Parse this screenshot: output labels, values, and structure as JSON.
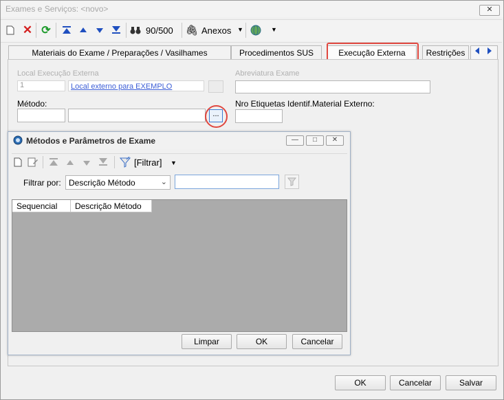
{
  "window": {
    "title": "Exames e Serviços: <novo>",
    "close_label": "✕"
  },
  "toolbar": {
    "counter": "90/500",
    "attachments_label": "Anexos",
    "icons": [
      "new-icon",
      "delete-icon",
      "refresh-icon",
      "first-icon",
      "prev-icon",
      "next-icon",
      "last-icon",
      "binoculars-icon",
      "paperclip-icon",
      "dropdown-arrow-icon",
      "globe-icon",
      "dropdown-arrow-icon"
    ]
  },
  "tabs": [
    {
      "label": "Materiais do Exame / Preparações / Vasilhames",
      "active": false
    },
    {
      "label": "Procedimentos SUS",
      "active": false
    },
    {
      "label": "Execução Externa",
      "active": true
    },
    {
      "label": "Restrições",
      "active": false
    }
  ],
  "form": {
    "local_label": "Local Execução Externa",
    "local_code": "1",
    "local_link": "Local externo para EXEMPLO",
    "abrev_label": "Abreviatura Exame",
    "metodo_label": "Método:",
    "metodo_code": "",
    "metodo_desc": "",
    "lookup_button": "...",
    "etiquetas_label": "Nro Etiquetas Identif.Material Externo:",
    "etiquetas_value": ""
  },
  "dialog": {
    "title": "Métodos e Parâmetros de Exame",
    "filter_button": "[Filtrar]",
    "filter_by_label": "Filtrar por:",
    "filter_field_selected": "Descrição Método",
    "filter_value": "",
    "columns": [
      "Sequencial",
      "Descrição Método"
    ],
    "rows": [],
    "buttons": {
      "clear": "Limpar",
      "ok": "OK",
      "cancel": "Cancelar"
    }
  },
  "footer": {
    "ok": "OK",
    "cancel": "Cancelar",
    "save": "Salvar"
  },
  "colors": {
    "highlight": "#e0473f",
    "grid_background": "#ababab",
    "link": "#3b5dd6"
  }
}
